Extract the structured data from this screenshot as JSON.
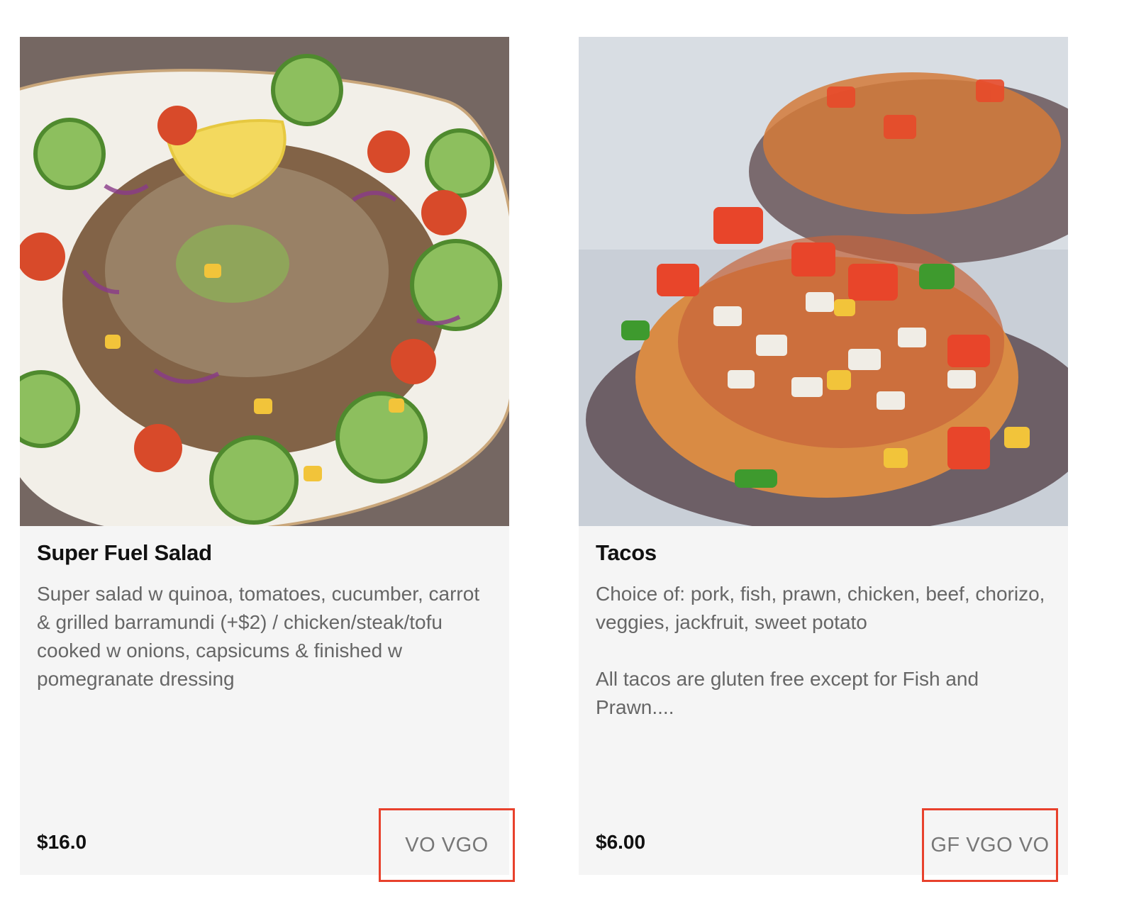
{
  "menu_items": [
    {
      "title": "Super Fuel Salad",
      "description": [
        "Super salad w quinoa, tomatoes, cucumber, carrot & grilled barramundi (+$2) / chicken/steak/tofu cooked w onions, capsicums & finished w pomegranate dressing"
      ],
      "price": "$16.0",
      "tags": "VO VGO",
      "image": "salad-photo"
    },
    {
      "title": "Tacos",
      "description": [
        "Choice of: pork, fish, prawn, chicken, beef, chorizo, veggies,  jackfruit, sweet potato",
        "All tacos are gluten free except for Fish and Prawn...."
      ],
      "price": "$6.00",
      "tags": "GF VGO VO",
      "image": "tacos-photo"
    }
  ],
  "colors": {
    "highlight_border": "#e8412c",
    "card_bg": "#f5f5f5"
  }
}
